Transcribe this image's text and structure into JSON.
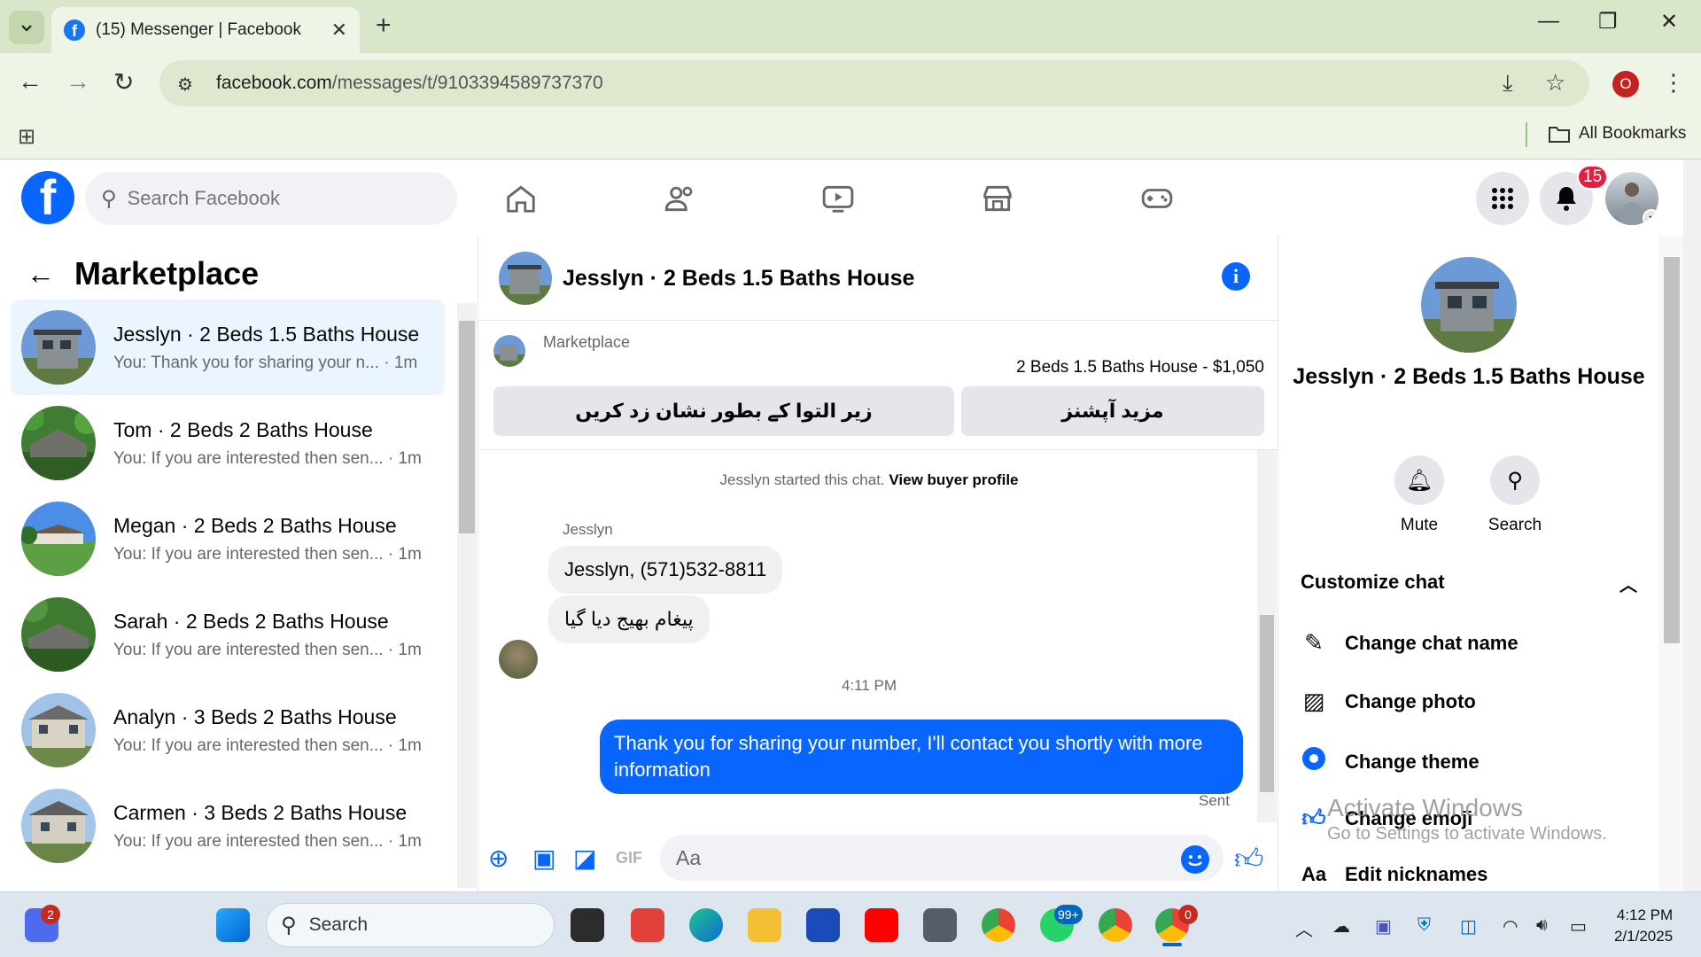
{
  "browser": {
    "tab_title": "(15) Messenger | Facebook",
    "url_domain": "facebook.com",
    "url_path": "/messages/t/9103394589737370",
    "profile_initial": "O",
    "bookmarks_label": "All Bookmarks"
  },
  "fb": {
    "search_placeholder": "Search Facebook",
    "notification_count": "15"
  },
  "left": {
    "title": "Marketplace",
    "chats": [
      {
        "name": "Jesslyn · 2 Beds 1.5 Baths House",
        "snippet": "You: Thank you for sharing your n...",
        "time": "· 1m",
        "active": true
      },
      {
        "name": "Tom · 2 Beds 2 Baths House",
        "snippet": "You: If you are interested then sen...",
        "time": "· 1m"
      },
      {
        "name": "Megan · 2 Beds 2 Baths House",
        "snippet": "You: If you are interested then sen...",
        "time": "· 1m"
      },
      {
        "name": "Sarah · 2 Beds 2 Baths House",
        "snippet": "You: If you are interested then sen...",
        "time": "· 1m"
      },
      {
        "name": "Analyn · 3 Beds 2 Baths House",
        "snippet": "You: If you are interested then sen...",
        "time": "· 1m"
      },
      {
        "name": "Carmen · 3 Beds 2 Baths House",
        "snippet": "You: If you are interested then sen...",
        "time": "· 1m"
      }
    ]
  },
  "conversation": {
    "title": "Jesslyn · 2 Beds 1.5 Baths House",
    "listing_source": "Marketplace",
    "listing_price": "2 Beds 1.5 Baths House - $1,050",
    "btn_mark_pending": "زیر التوا کے بطور نشان زد کریں",
    "btn_more_options": "مزید آپشنز",
    "started_text": "Jesslyn started this chat.",
    "view_profile": "View buyer profile",
    "sender": "Jesslyn",
    "msg1": "Jesslyn, (571)532-8811",
    "msg2": "پیغام بھیج دیا گیا",
    "timestamp": "4:11 PM",
    "msg_out": "Thank you for sharing your number, I'll contact you shortly with more information",
    "status": "Sent",
    "composer_placeholder": "Aa"
  },
  "details": {
    "name": "Jesslyn · 2 Beds 1.5 Baths House",
    "mute": "Mute",
    "search": "Search",
    "customize": "Customize chat",
    "items": [
      "Change chat name",
      "Change photo",
      "Change theme",
      "Change emoji",
      "Edit nicknames"
    ]
  },
  "watermark": {
    "title": "Activate Windows",
    "subtitle": "Go to Settings to activate Windows."
  },
  "taskbar": {
    "search": "Search",
    "meet_badge": "2",
    "whatsapp_badge": "99+",
    "chrome_badge": "0",
    "time": "4:12 PM",
    "date": "2/1/2025"
  },
  "colors": {
    "fb_blue": "#0866ff",
    "active_chat_bg": "#ebf5ff",
    "chrome_tabbar": "#d9e6c9"
  }
}
